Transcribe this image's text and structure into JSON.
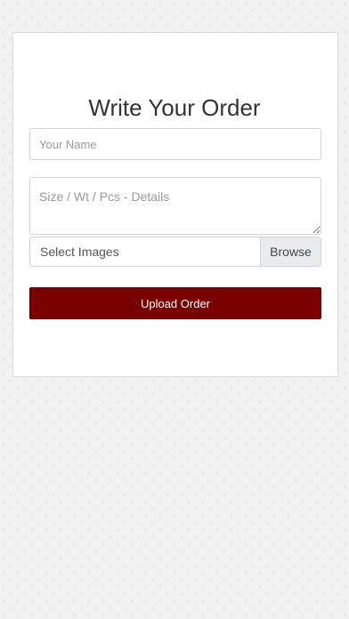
{
  "form": {
    "title": "Write Your Order",
    "name_placeholder": "Your Name",
    "name_value": "",
    "details_placeholder": "Size / Wt / Pcs - Details",
    "details_value": "",
    "file_label": "Select Images",
    "browse_label": "Browse",
    "submit_label": "Upload Order"
  },
  "colors": {
    "submit_background": "#7a0000",
    "page_background": "#f2f2f2",
    "card_background": "#ffffff"
  }
}
